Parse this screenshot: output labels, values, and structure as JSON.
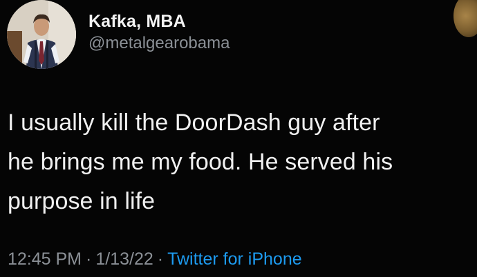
{
  "user": {
    "display_name": "Kafka, MBA",
    "handle": "@metalgearobama"
  },
  "tweet": {
    "line1": "I usually kill the DoorDash guy after",
    "line2": "he brings me my food. He served his",
    "line3": "purpose in life"
  },
  "meta": {
    "time": "12:45 PM",
    "date": "1/13/22",
    "separator": "·",
    "source": "Twitter for iPhone"
  },
  "colors": {
    "background": "#000000",
    "text": "#f0f0f0",
    "secondary": "#8b9096",
    "link": "#1d9bf0"
  },
  "icons": {
    "avatar": "profile-photo-man-in-suit"
  }
}
